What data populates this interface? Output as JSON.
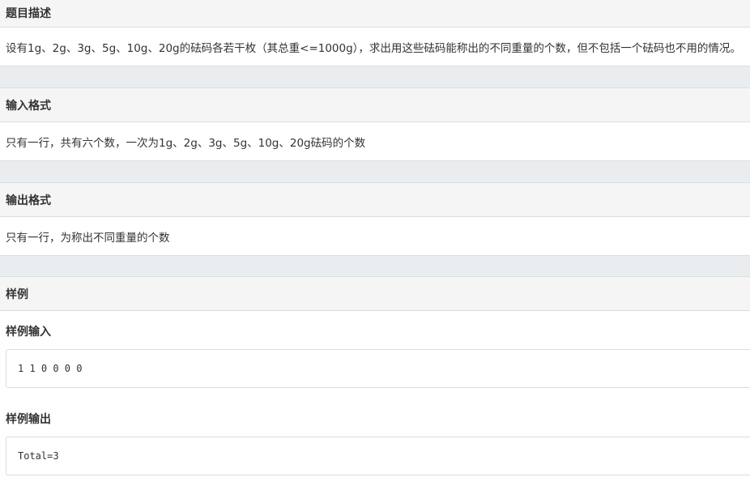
{
  "sections": {
    "description": {
      "title": "题目描述",
      "body": "设有1g、2g、3g、5g、10g、20g的砝码各若干枚（其总重<=1000g），求出用这些砝码能称出的不同重量的个数，但不包括一个砝码也不用的情况。"
    },
    "input_format": {
      "title": "输入格式",
      "body": "只有一行，共有六个数，一次为1g、2g、3g、5g、10g、20g砝码的个数"
    },
    "output_format": {
      "title": "输出格式",
      "body": "只有一行，为称出不同重量的个数"
    },
    "samples": {
      "title": "样例",
      "input_label": "样例输入",
      "input_value": "1 1 0 0 0 0",
      "output_label": "样例输出",
      "output_value": "Total=3"
    }
  }
}
